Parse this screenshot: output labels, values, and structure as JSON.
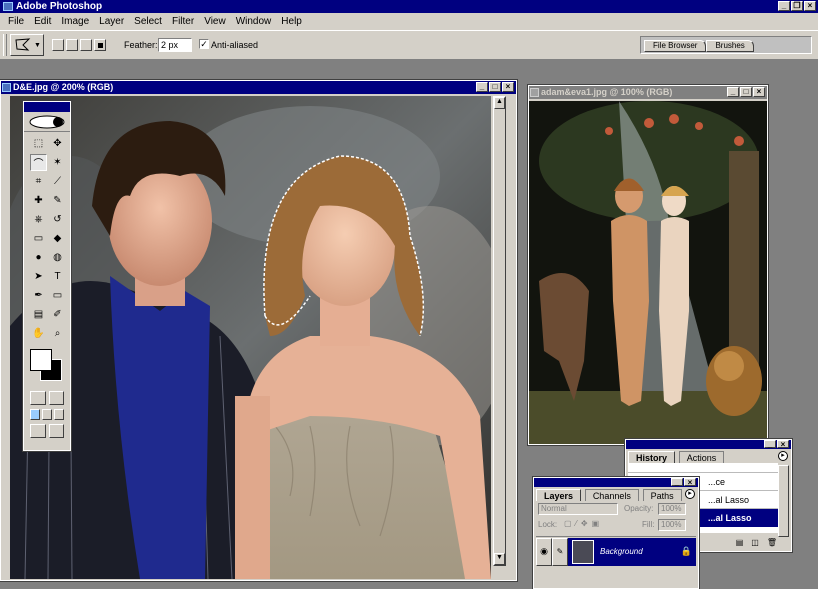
{
  "app": {
    "title": "Adobe Photoshop"
  },
  "menu": [
    "File",
    "Edit",
    "Image",
    "Layer",
    "Select",
    "Filter",
    "View",
    "Window",
    "Help"
  ],
  "options": {
    "feather_label": "Feather:",
    "feather_value": "2 px",
    "antialias_label": "Anti-aliased",
    "antialias_checked": true,
    "palette_tabs": [
      "File Browser",
      "Brushes"
    ]
  },
  "doc1": {
    "title": "D&E.jpg @ 200% (RGB)"
  },
  "doc2": {
    "title": "adam&eva1.jpg @ 100% (RGB)"
  },
  "history": {
    "tabs": [
      "History",
      "Actions"
    ],
    "items": [
      "...ce",
      "...al Lasso",
      "...al Lasso"
    ]
  },
  "layers": {
    "tabs": [
      "Layers",
      "Channels",
      "Paths"
    ],
    "blend_mode": "Normal",
    "opacity_label": "Opacity:",
    "opacity_value": "100%",
    "lock_label": "Lock:",
    "fill_label": "Fill:",
    "fill_value": "100%",
    "layer_name": "Background"
  },
  "colors": {
    "title_active": "#000080",
    "chrome": "#d4d0c8",
    "desktop": "#808080"
  }
}
